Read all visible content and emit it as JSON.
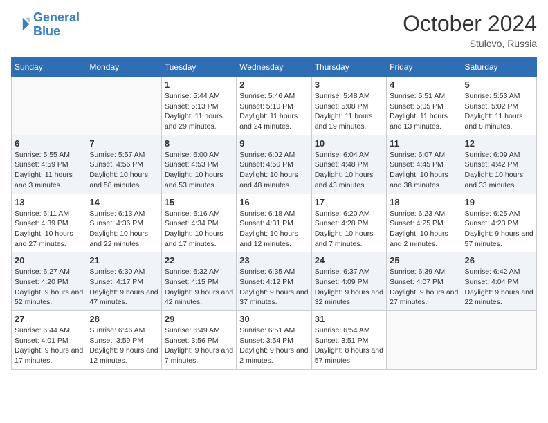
{
  "header": {
    "logo_line1": "General",
    "logo_line2": "Blue",
    "month": "October 2024",
    "location": "Stulovo, Russia"
  },
  "weekdays": [
    "Sunday",
    "Monday",
    "Tuesday",
    "Wednesday",
    "Thursday",
    "Friday",
    "Saturday"
  ],
  "weeks": [
    [
      {
        "day": "",
        "info": ""
      },
      {
        "day": "",
        "info": ""
      },
      {
        "day": "1",
        "info": "Sunrise: 5:44 AM\nSunset: 5:13 PM\nDaylight: 11 hours and 29 minutes."
      },
      {
        "day": "2",
        "info": "Sunrise: 5:46 AM\nSunset: 5:10 PM\nDaylight: 11 hours and 24 minutes."
      },
      {
        "day": "3",
        "info": "Sunrise: 5:48 AM\nSunset: 5:08 PM\nDaylight: 11 hours and 19 minutes."
      },
      {
        "day": "4",
        "info": "Sunrise: 5:51 AM\nSunset: 5:05 PM\nDaylight: 11 hours and 13 minutes."
      },
      {
        "day": "5",
        "info": "Sunrise: 5:53 AM\nSunset: 5:02 PM\nDaylight: 11 hours and 8 minutes."
      }
    ],
    [
      {
        "day": "6",
        "info": "Sunrise: 5:55 AM\nSunset: 4:59 PM\nDaylight: 11 hours and 3 minutes."
      },
      {
        "day": "7",
        "info": "Sunrise: 5:57 AM\nSunset: 4:56 PM\nDaylight: 10 hours and 58 minutes."
      },
      {
        "day": "8",
        "info": "Sunrise: 6:00 AM\nSunset: 4:53 PM\nDaylight: 10 hours and 53 minutes."
      },
      {
        "day": "9",
        "info": "Sunrise: 6:02 AM\nSunset: 4:50 PM\nDaylight: 10 hours and 48 minutes."
      },
      {
        "day": "10",
        "info": "Sunrise: 6:04 AM\nSunset: 4:48 PM\nDaylight: 10 hours and 43 minutes."
      },
      {
        "day": "11",
        "info": "Sunrise: 6:07 AM\nSunset: 4:45 PM\nDaylight: 10 hours and 38 minutes."
      },
      {
        "day": "12",
        "info": "Sunrise: 6:09 AM\nSunset: 4:42 PM\nDaylight: 10 hours and 33 minutes."
      }
    ],
    [
      {
        "day": "13",
        "info": "Sunrise: 6:11 AM\nSunset: 4:39 PM\nDaylight: 10 hours and 27 minutes."
      },
      {
        "day": "14",
        "info": "Sunrise: 6:13 AM\nSunset: 4:36 PM\nDaylight: 10 hours and 22 minutes."
      },
      {
        "day": "15",
        "info": "Sunrise: 6:16 AM\nSunset: 4:34 PM\nDaylight: 10 hours and 17 minutes."
      },
      {
        "day": "16",
        "info": "Sunrise: 6:18 AM\nSunset: 4:31 PM\nDaylight: 10 hours and 12 minutes."
      },
      {
        "day": "17",
        "info": "Sunrise: 6:20 AM\nSunset: 4:28 PM\nDaylight: 10 hours and 7 minutes."
      },
      {
        "day": "18",
        "info": "Sunrise: 6:23 AM\nSunset: 4:25 PM\nDaylight: 10 hours and 2 minutes."
      },
      {
        "day": "19",
        "info": "Sunrise: 6:25 AM\nSunset: 4:23 PM\nDaylight: 9 hours and 57 minutes."
      }
    ],
    [
      {
        "day": "20",
        "info": "Sunrise: 6:27 AM\nSunset: 4:20 PM\nDaylight: 9 hours and 52 minutes."
      },
      {
        "day": "21",
        "info": "Sunrise: 6:30 AM\nSunset: 4:17 PM\nDaylight: 9 hours and 47 minutes."
      },
      {
        "day": "22",
        "info": "Sunrise: 6:32 AM\nSunset: 4:15 PM\nDaylight: 9 hours and 42 minutes."
      },
      {
        "day": "23",
        "info": "Sunrise: 6:35 AM\nSunset: 4:12 PM\nDaylight: 9 hours and 37 minutes."
      },
      {
        "day": "24",
        "info": "Sunrise: 6:37 AM\nSunset: 4:09 PM\nDaylight: 9 hours and 32 minutes."
      },
      {
        "day": "25",
        "info": "Sunrise: 6:39 AM\nSunset: 4:07 PM\nDaylight: 9 hours and 27 minutes."
      },
      {
        "day": "26",
        "info": "Sunrise: 6:42 AM\nSunset: 4:04 PM\nDaylight: 9 hours and 22 minutes."
      }
    ],
    [
      {
        "day": "27",
        "info": "Sunrise: 6:44 AM\nSunset: 4:01 PM\nDaylight: 9 hours and 17 minutes."
      },
      {
        "day": "28",
        "info": "Sunrise: 6:46 AM\nSunset: 3:59 PM\nDaylight: 9 hours and 12 minutes."
      },
      {
        "day": "29",
        "info": "Sunrise: 6:49 AM\nSunset: 3:56 PM\nDaylight: 9 hours and 7 minutes."
      },
      {
        "day": "30",
        "info": "Sunrise: 6:51 AM\nSunset: 3:54 PM\nDaylight: 9 hours and 2 minutes."
      },
      {
        "day": "31",
        "info": "Sunrise: 6:54 AM\nSunset: 3:51 PM\nDaylight: 8 hours and 57 minutes."
      },
      {
        "day": "",
        "info": ""
      },
      {
        "day": "",
        "info": ""
      }
    ]
  ]
}
